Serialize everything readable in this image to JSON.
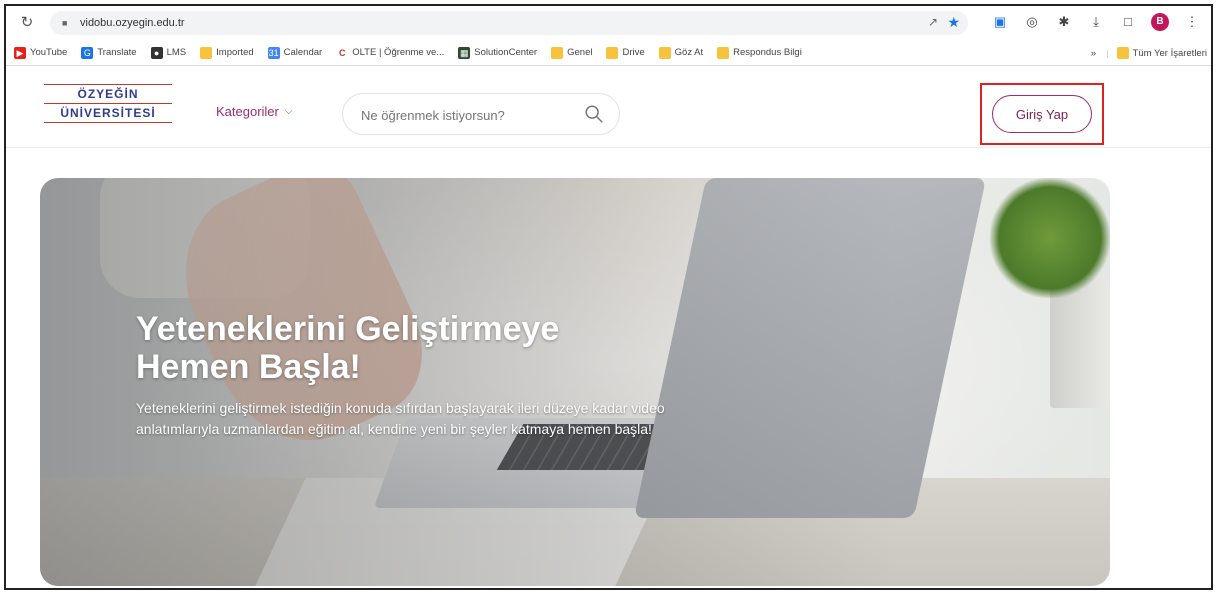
{
  "browser": {
    "url": "vidobu.ozyegin.edu.tr",
    "avatar_letter": "B",
    "bookmarks": [
      {
        "label": "YouTube",
        "icon": "youtube-icon"
      },
      {
        "label": "Translate",
        "icon": "translate-icon"
      },
      {
        "label": "LMS",
        "icon": "lms-icon"
      },
      {
        "label": "Imported",
        "icon": "folder-icon"
      },
      {
        "label": "Calendar",
        "icon": "calendar-icon"
      },
      {
        "label": "OLTE | Öğrenme ve...",
        "icon": "olte-icon"
      },
      {
        "label": "SolutionCenter",
        "icon": "solution-icon"
      },
      {
        "label": "Genel",
        "icon": "folder-icon"
      },
      {
        "label": "Drive",
        "icon": "folder-icon"
      },
      {
        "label": "Göz At",
        "icon": "folder-icon"
      },
      {
        "label": "Respondus Bilgi",
        "icon": "folder-icon"
      }
    ],
    "bookmarks_overflow": "»",
    "all_bookmarks": "Tüm Yer İşaretleri"
  },
  "site": {
    "logo_top": "ÖZYEĞİN",
    "logo_bottom": "ÜNİVERSİTESİ",
    "categories_label": "Kategoriler",
    "search_placeholder": "Ne öğrenmek istiyorsun?",
    "login_label": "Giriş Yap",
    "accent_color": "#9b2c6e",
    "highlight_color": "#dd2222"
  },
  "hero": {
    "title_line1": "Yeteneklerini Geliştirmeye",
    "title_line2": "Hemen Başla!",
    "subtitle": "Yeteneklerini geliştirmek istediğin konuda sıfırdan başlayarak ileri düzeye kadar video anlatımlarıyla uzmanlardan eğitim al, kendine yeni bir şeyler katmaya hemen başla!"
  }
}
